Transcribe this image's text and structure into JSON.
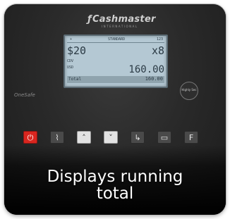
{
  "device": {
    "brand": "Cashmaster",
    "brand_sub": "INTERNATIONAL",
    "left_logo": "OneSafe",
    "round_button_label": "Highly Sec"
  },
  "lcd": {
    "header": {
      "left": "+",
      "middle": "STANDARD",
      "right": "123"
    },
    "denomination": "$20",
    "multiplier": "x8",
    "sub_label": "CDV",
    "amount_label": "USD",
    "amount": "160.00",
    "total_label": "Total",
    "total_value": "160.00"
  },
  "keys": {
    "power": "⏻",
    "drawer": "⌇",
    "up": "˄",
    "down": "˅",
    "add": "↳",
    "print": "▭",
    "function": "F"
  },
  "caption": {
    "line1": "Displays running",
    "line2": "total"
  }
}
